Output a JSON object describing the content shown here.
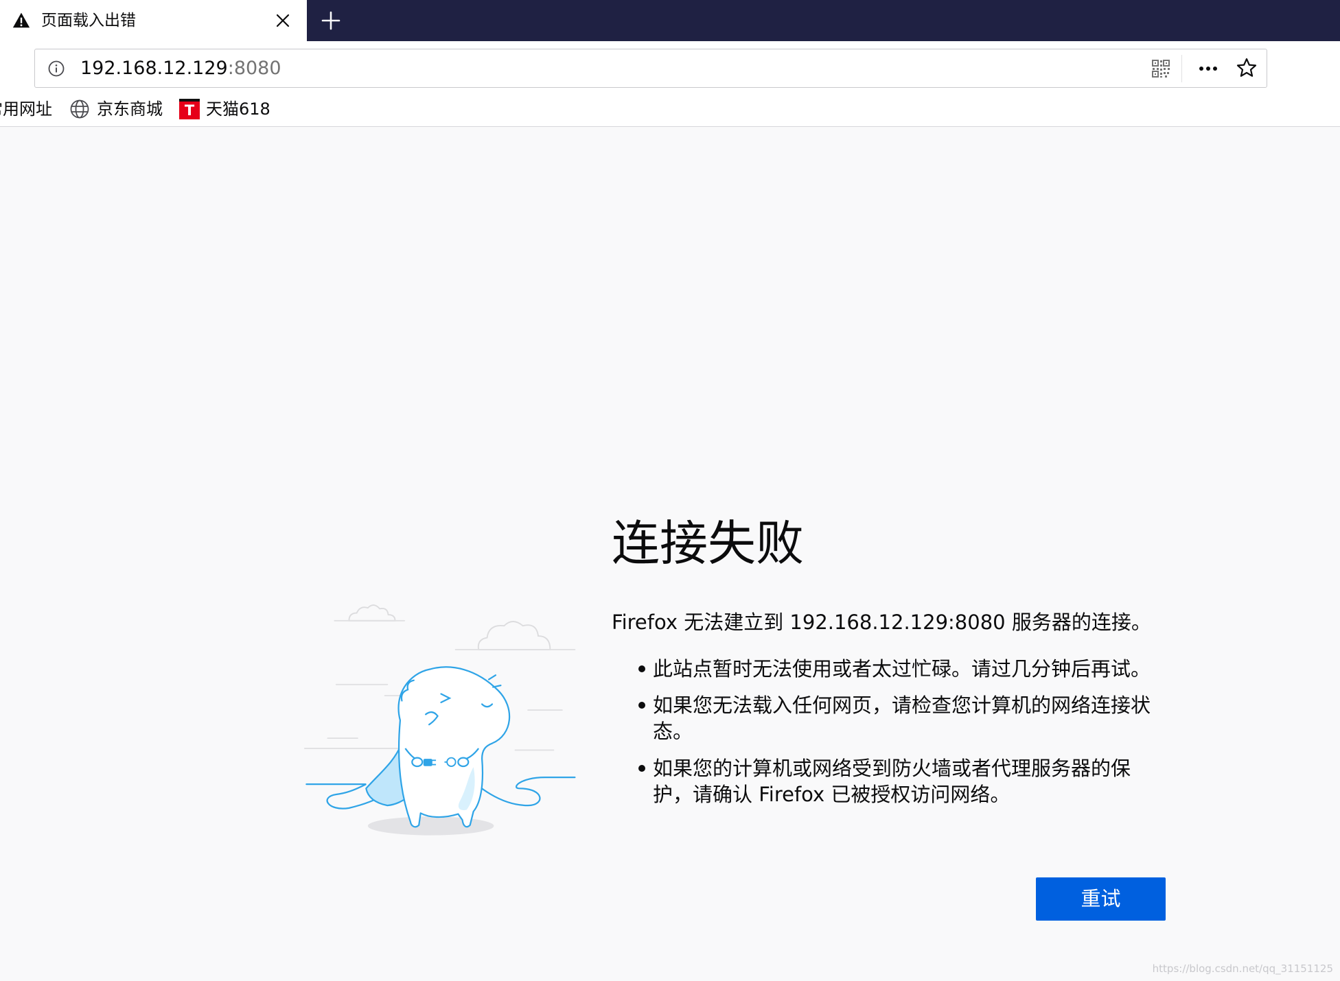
{
  "browser": {
    "tab": {
      "title": "页面载入出错",
      "status_icon": "warning-icon",
      "close_icon": "close-icon"
    },
    "new_tab_icon": "plus-icon",
    "address_bar": {
      "host": "192.168.12.129",
      "port": ":8080",
      "site_info_icon": "info-icon",
      "qr_icon": "qr-code-icon",
      "page_actions_icon": "more-horizontal-icon",
      "bookmark_icon": "star-icon"
    },
    "bookmarks": [
      {
        "label": "常用网址"
      },
      {
        "label": "京东商城",
        "icon": "globe-icon"
      },
      {
        "label": "天猫618",
        "icon": "tmall-icon"
      }
    ]
  },
  "colors": {
    "tab_strip": "#1f2143",
    "page_background": "#f9f9fa",
    "primary_button": "#0060df",
    "illustration_stroke": "#2fa4e7"
  },
  "error": {
    "title": "连接失败",
    "intro": "Firefox 无法建立到 192.168.12.129:8080 服务器的连接。",
    "bullets": [
      {
        "lines": [
          "此站点暂时无法使用或者太过忙碌。请过几分钟后再试。"
        ]
      },
      {
        "lines": [
          "如果您无法载入任何网页，请检查您计算机的网络连接状",
          "态。"
        ]
      },
      {
        "lines": [
          "如果您的计算机或网络受到防火墙或者代理服务器的保",
          "护，请确认 Firefox 已被授权访问网络。"
        ]
      }
    ],
    "retry_label": "重试",
    "illustration": "dinosaur-unplugged-illustration"
  },
  "watermark": "https://blog.csdn.net/qq_31151125"
}
